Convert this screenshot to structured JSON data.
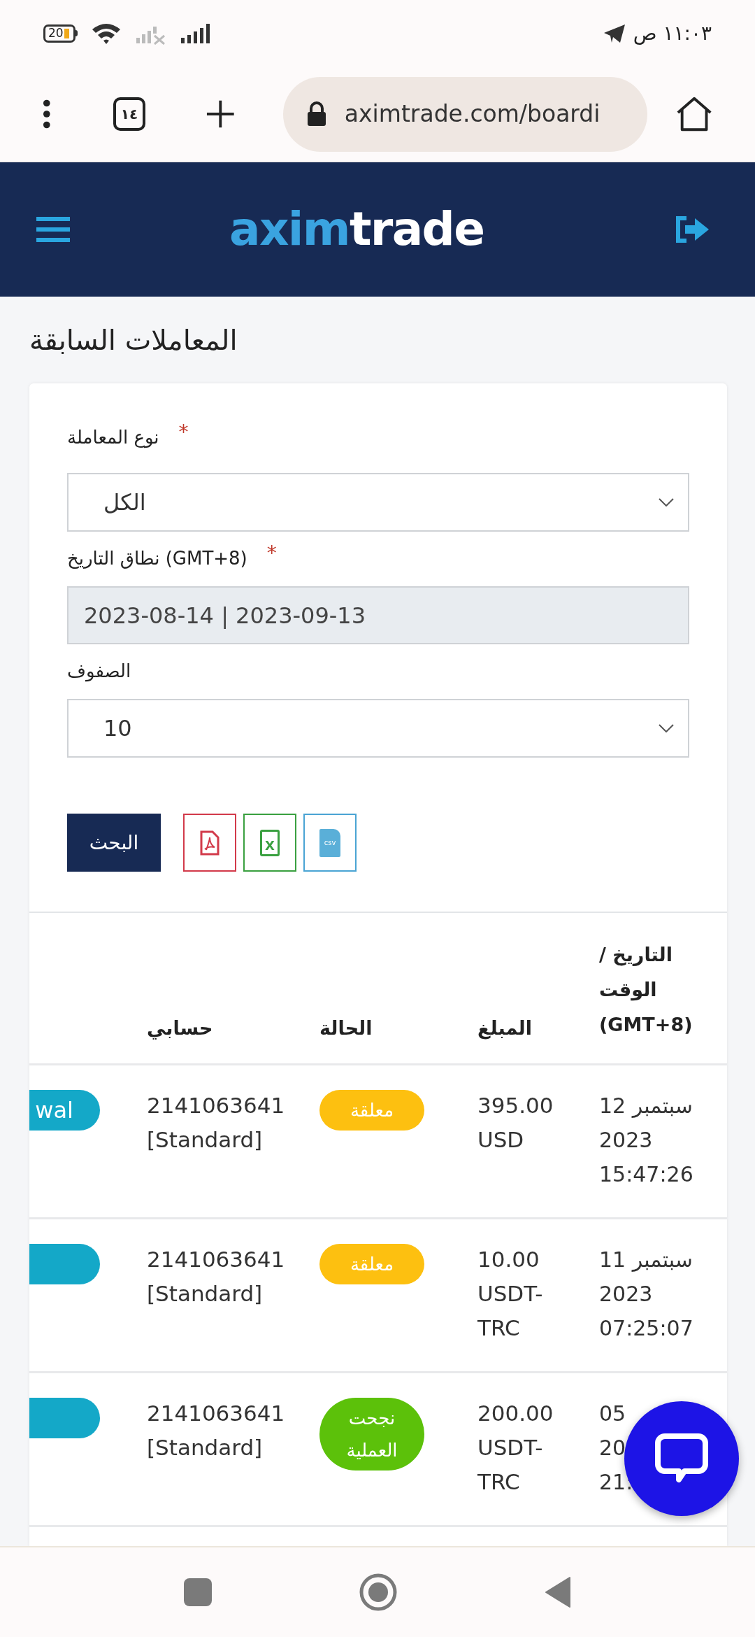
{
  "status_bar": {
    "battery": "20",
    "time": "١١:٠٣ ص"
  },
  "browser": {
    "tab_count": "١٤",
    "url": "aximtrade.com/boardi"
  },
  "header": {
    "logo": {
      "accent": "axim",
      "rest": "trade"
    }
  },
  "page_title": "المعاملات السابقة",
  "form": {
    "fields": [
      {
        "kind": "select",
        "label": "نوع المعاملة",
        "required_mark": "*",
        "value": "الكل"
      },
      {
        "kind": "date_range",
        "label": "نطاق التاريخ (GMT+8)",
        "required_mark": "*",
        "value": "2023-08-14 | 2023-09-13"
      },
      {
        "kind": "select",
        "label": "الصفوف",
        "value": "10"
      }
    ],
    "search_button": "البحث",
    "exports": [
      {
        "kind": "csv",
        "label": "csv"
      },
      {
        "kind": "xls",
        "label": "X"
      },
      {
        "kind": "pdf"
      }
    ]
  },
  "table": {
    "columns": [
      "التاريخ / الوقت (GMT+8)",
      "المبلغ",
      "الحالة",
      "حسابي"
    ],
    "rows": [
      {
        "type_label": "wal",
        "account": [
          "2141063641",
          "[Standard]"
        ],
        "status": {
          "label": "معلقة",
          "color": "#fdc010"
        },
        "amount": [
          "395.00",
          "USD"
        ],
        "date": [
          "سبتمبر 12",
          "2023",
          "15:47:26"
        ]
      },
      {
        "account": [
          "2141063641",
          "[Standard]"
        ],
        "status": {
          "label": "معلقة",
          "color": "#fdc010"
        },
        "amount": [
          "10.00",
          "USDT-",
          "TRC"
        ],
        "date": [
          "سبتمبر 11",
          "2023",
          "07:25:07"
        ]
      },
      {
        "account": [
          "2141063641",
          "[Standard]"
        ],
        "status": {
          "label": "نجحت العملية",
          "color": "#5cc10a"
        },
        "amount": [
          "200.00",
          "USDT-",
          "TRC"
        ],
        "date": [
          "05",
          "20",
          "21:"
        ]
      }
    ]
  }
}
